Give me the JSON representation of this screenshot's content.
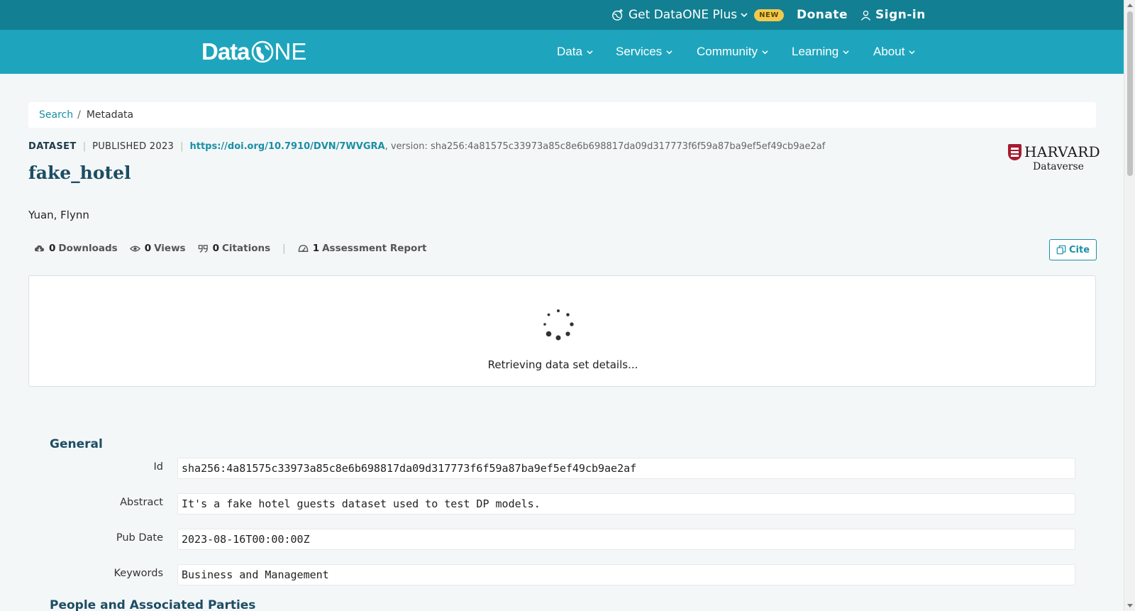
{
  "topbar": {
    "plus_label": "Get DataONE Plus",
    "new_badge": "NEW",
    "donate": "Donate",
    "signin": "Sign-in"
  },
  "nav": {
    "logo_left": "Data",
    "logo_right": "NE",
    "items": [
      "Data",
      "Services",
      "Community",
      "Learning",
      "About"
    ]
  },
  "breadcrumb": {
    "link": "Search",
    "separator": "/",
    "current": "Metadata"
  },
  "dataset": {
    "type": "DATASET",
    "published": "PUBLISHED 2023",
    "doi": "https://doi.org/10.7910/DVN/7WVGRA",
    "version_text": ", version: sha256:4a81575c33973a85c8e6b698817da09d317773f6f59a87ba9ef5ef49cb9ae2af",
    "title": "fake_hotel",
    "authors": "Yuan, Flynn",
    "repository_name": "HARVARD",
    "repository_sub": "Dataverse"
  },
  "stats": {
    "downloads_num": "0",
    "downloads_label": "Downloads",
    "views_num": "0",
    "views_label": "Views",
    "citations_num": "0",
    "citations_label": "Citations",
    "separator": "|",
    "assessment_num": "1",
    "assessment_label": "Assessment Report"
  },
  "cite_button": "Cite",
  "loading_text": "Retrieving data set details...",
  "general": {
    "title": "General",
    "id_label": "Id",
    "id_value": "sha256:4a81575c33973a85c8e6b698817da09d317773f6f59a87ba9ef5ef49cb9ae2af",
    "abstract_label": "Abstract",
    "abstract_value": "It's a fake hotel guests dataset used to test DP models.",
    "pubdate_label": "Pub Date",
    "pubdate_value": "2023-08-16T00:00:00Z",
    "keywords_label": "Keywords",
    "keywords_value": "Business and Management"
  },
  "people_section_title": "People and Associated Parties",
  "colors": {
    "topbar": "#127f92",
    "navbar": "#1ea5bd",
    "link": "#1a8fa5",
    "title": "#1d4d63",
    "badge": "#f2c94c"
  }
}
